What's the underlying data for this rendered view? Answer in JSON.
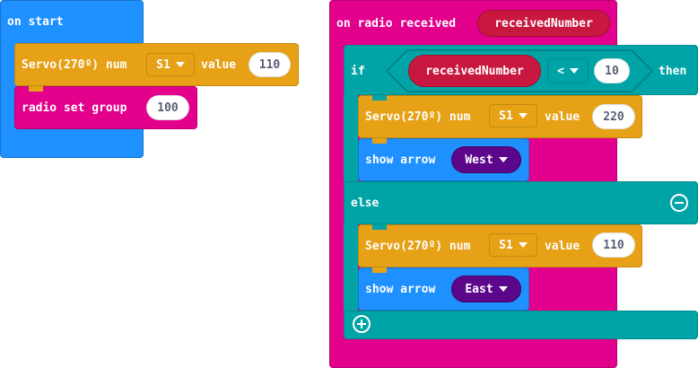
{
  "colors": {
    "event": "#1E90FF",
    "servo": "#E6A117",
    "radio": "#E3008C",
    "logic": "#00A4A6",
    "variable": "#C8183F",
    "arrow_dropdown": "#5C068C"
  },
  "on_start": {
    "label": "on start",
    "servo": {
      "label": "Servo(270º) num",
      "pin": "S1",
      "value_label": "value",
      "value": "110"
    },
    "radio": {
      "label": "radio set group",
      "value": "100"
    }
  },
  "on_radio": {
    "label": "on radio received",
    "param": "receivedNumber",
    "if": {
      "if_label": "if",
      "then_label": "then",
      "var": "receivedNumber",
      "op": "<",
      "compare": "10"
    },
    "then_branch": {
      "servo": {
        "label": "Servo(270º) num",
        "pin": "S1",
        "value_label": "value",
        "value": "220"
      },
      "arrow": {
        "label": "show arrow",
        "dir": "West"
      }
    },
    "else_label": "else",
    "else_branch": {
      "servo": {
        "label": "Servo(270º) num",
        "pin": "S1",
        "value_label": "value",
        "value": "110"
      },
      "arrow": {
        "label": "show arrow",
        "dir": "East"
      }
    },
    "remove_icon": "minus-circle-icon",
    "add_icon": "plus-circle-icon"
  }
}
